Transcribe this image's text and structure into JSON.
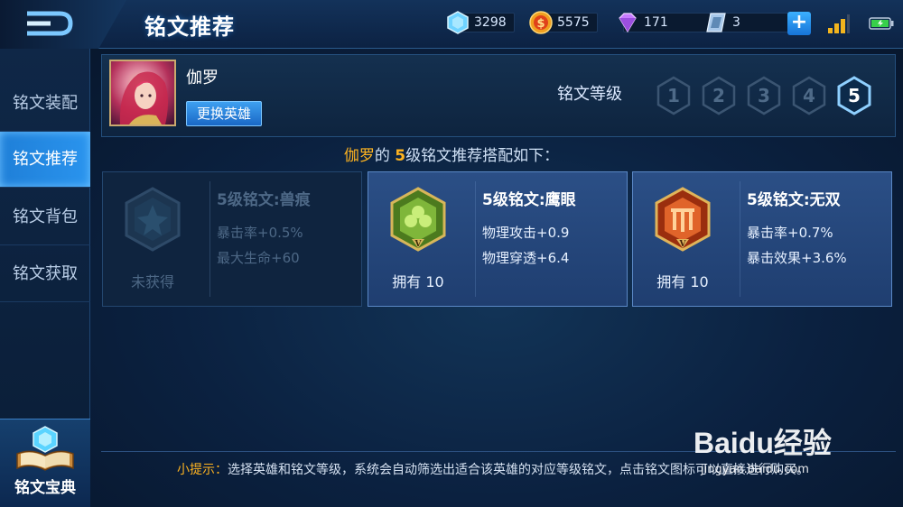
{
  "header": {
    "title": "铭文推荐",
    "resources": [
      {
        "icon": "diamond-icon",
        "value": "3298"
      },
      {
        "icon": "gold-coin-icon",
        "value": "5575"
      },
      {
        "icon": "purple-gem-icon",
        "value": "171"
      },
      {
        "icon": "ticket-card-icon",
        "value": "3"
      }
    ],
    "add_icon": "plus-icon",
    "signal_icon": "signal-icon",
    "battery_icon": "battery-icon"
  },
  "sidebar": {
    "items": [
      {
        "label": "铭文装配",
        "active": false
      },
      {
        "label": "铭文推荐",
        "active": true
      },
      {
        "label": "铭文背包",
        "active": false
      },
      {
        "label": "铭文获取",
        "active": false
      }
    ],
    "book_label": "铭文宝典"
  },
  "hero": {
    "name": "伽罗",
    "change_button": "更换英雄",
    "level_label": "铭文等级",
    "levels": [
      "1",
      "2",
      "3",
      "4",
      "5"
    ],
    "selected_level": "5"
  },
  "headline": {
    "hero": "伽罗",
    "part1": "的 ",
    "level": "5",
    "part2": "级铭文推荐搭配如下："
  },
  "runes": [
    {
      "name": "5级铭文:兽痕",
      "stat1": "暴击率+0.5%",
      "stat2": "最大生命+60",
      "owned": "未获得",
      "color": "#2b3f55"
    },
    {
      "name": "5级铭文:鹰眼",
      "stat1": "物理攻击+0.9",
      "stat2": "物理穿透+6.4",
      "owned": "拥有 10",
      "color": "#5a9a2a"
    },
    {
      "name": "5级铭文:无双",
      "stat1": "暴击率+0.7%",
      "stat2": "暴击效果+3.6%",
      "owned": "拥有 10",
      "color": "#c8501c"
    }
  ],
  "tip": {
    "label": "小提示：",
    "text": "选择英雄和铭文等级，系统会自动筛选出适合该英雄的对应等级铭文，点击铭文图标可以直接进行购买。"
  },
  "watermark": {
    "logo": "Baidu经验",
    "url": "jingyan.baidu.com"
  }
}
